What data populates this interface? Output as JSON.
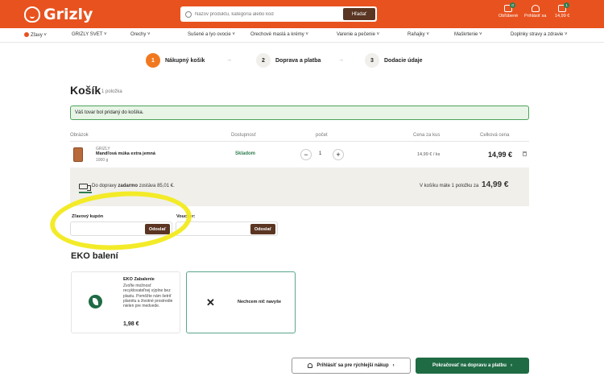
{
  "header": {
    "logo": "Grizly",
    "search_placeholder": "Názov produktu, kategória alebo kód",
    "search_button": "Hľadať",
    "favorites_label": "Obľúbené",
    "favorites_count": "0",
    "login_label": "Prihlásiť sa",
    "cart_label": "14,99 €",
    "cart_count": "1"
  },
  "nav": {
    "items": [
      "Zľavy",
      "GRIZLY SVET",
      "Orechy",
      "Sušené a lyo ovocie",
      "Orechové maslá a krémy",
      "Varenie a pečenie",
      "Raňajky",
      "Maškrtenie",
      "Doplnky stravy a zdravie"
    ]
  },
  "steps": [
    {
      "num": "1",
      "label": "Nákupný košík"
    },
    {
      "num": "2",
      "label": "Doprava a platba"
    },
    {
      "num": "3",
      "label": "Dodacie údaje"
    }
  ],
  "cart": {
    "title": "Košík",
    "count": "1 položka",
    "notice": "Váš tovar bol pridaný do košíka.",
    "columns": {
      "image": "Obrázok",
      "availability": "Dostupnosť",
      "qty": "počet",
      "unit_price": "Cena za kus",
      "total": "Celková cena"
    },
    "item": {
      "brand": "GRIZLY",
      "name": "Mandľová múka extra jemná",
      "weight": "1000 g",
      "availability": "Skladom",
      "quantity": "1",
      "unit_price": "14,99 € / ks",
      "total": "14,99 €"
    },
    "shipping_prefix": "Do dopravy",
    "shipping_free": "zadarmo",
    "shipping_suffix": "zostáva 85,01 €.",
    "summary_text": "V košíku máte 1 položku za",
    "summary_total": "14,99 €"
  },
  "coupon": {
    "label": "Zľavový kupón",
    "button": "Odoslať",
    "value": ""
  },
  "voucher": {
    "label": "Voucher:",
    "button": "Odoslať",
    "value": ""
  },
  "eco": {
    "title": "EKO balení",
    "option1_title": "EKO Zabalenie",
    "option1_desc": "Zvoľte možnosť recyklovateľnej výplne bez plastu. Pomôžte nám šetriť planétu a životné prostredie nielen pre medvede.",
    "option1_price": "1,98 €",
    "option2_label": "Nechcem nič navyše"
  },
  "actions": {
    "login": "Prihlásiť sa pre rýchlejší nákup",
    "continue": "Pokračovať na dopravu a platbu"
  },
  "colors": {
    "brand": "#e8521f",
    "dark_button": "#5a3522",
    "green": "#1f6b44",
    "highlight": "#f2ea1c"
  }
}
